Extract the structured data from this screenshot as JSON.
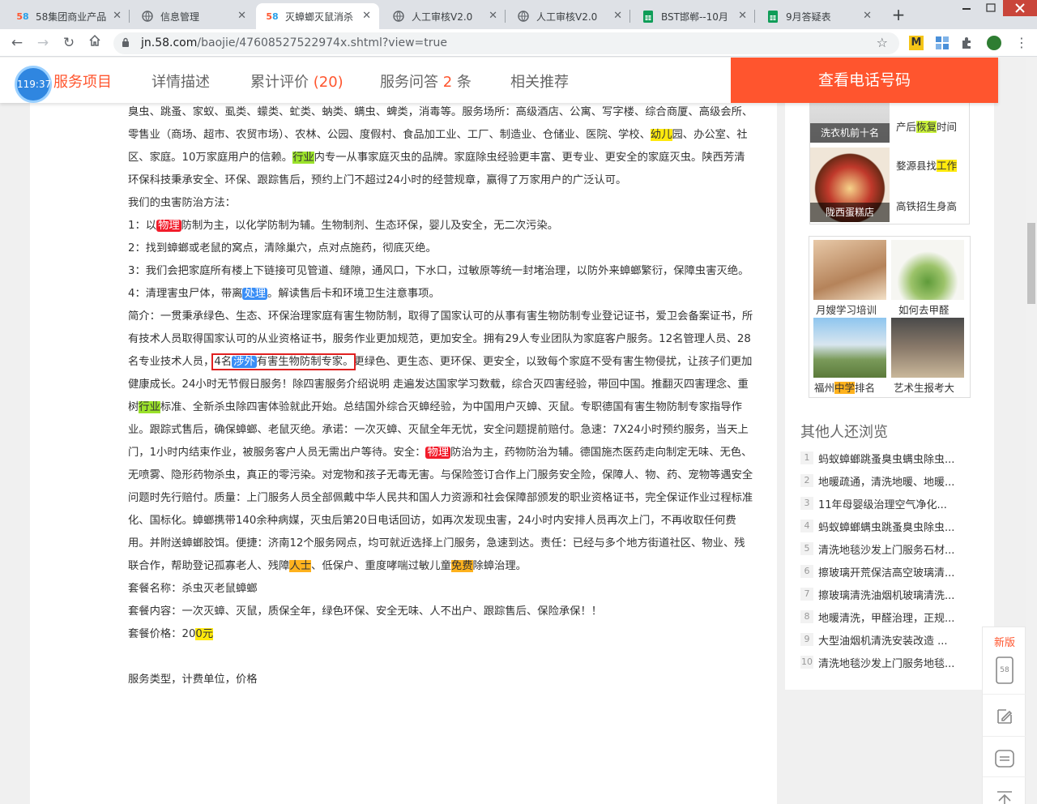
{
  "browser": {
    "tabs": [
      {
        "title": "58集团商业产品",
        "favicon": "58-logo",
        "active": false
      },
      {
        "title": "信息管理",
        "favicon": "globe-icon",
        "active": false
      },
      {
        "title": "灭蟑螂灭鼠消杀",
        "favicon": "58-logo",
        "active": true
      },
      {
        "title": "人工审核V2.0",
        "favicon": "globe-icon",
        "active": false
      },
      {
        "title": "人工审核V2.0",
        "favicon": "globe-icon",
        "active": false
      },
      {
        "title": "BST邯郸--10月",
        "favicon": "sheets-icon",
        "active": false
      },
      {
        "title": "9月答疑表",
        "favicon": "sheets-icon",
        "active": false
      }
    ],
    "url_host": "jn.58.com",
    "url_path": "/baojie/47608527522974x.shtml?view=true"
  },
  "nav": {
    "clock": "119:37",
    "items": [
      {
        "label": "服务项目"
      },
      {
        "label": "详情描述"
      },
      {
        "label": "累计评价 ",
        "count": "(20)"
      },
      {
        "label": "服务问答 ",
        "count": "2",
        "suffix": " 条"
      },
      {
        "label": "相关推荐"
      }
    ],
    "call_button": "查看电话号码"
  },
  "content": {
    "p1a": "臭虫、跳蚤、家蚁、虱类、蠓类、虻类、蚋类、螨虫、蜱类，消毒等。服务场所：高级酒店、公寓、写字楼、综合商厦、高级会所、零售业（商场、超市、农贸市场）、农林、公园、度假村、食品加工业、工厂、制造业、仓储业、医院、学校、",
    "p1b_hl": "幼儿",
    "p1c": "园、办公室、社区、家庭。10万家庭用户的信赖。",
    "p1d_hl": "行业",
    "p1e": "内专一从事家庭灭虫的品牌。家庭除虫经验更丰富、更专业、更安全的家庭灭虫。陕西芳清环保科技秉承安全、环保、跟踪售后，预约上门不超过24小时的经营规章，赢得了万家用户的广泛认可。",
    "methods_title": "我们的虫害防治方法：",
    "m1a": "1：以",
    "m1b_hl": "物理",
    "m1c": "防制为主，以化学防制为辅。生物制剂、生态环保，婴儿及安全，无二次污染。",
    "m2": "2：找到蟑螂或老鼠的窝点，清除巢穴，点对点施药，彻底灭绝。",
    "m3": "3：我们会把家庭所有楼上下链接可见管道、缝隙，通风口，下水口，过敏原等统一封堵治理，以防外来蟑螂繁衍，保障虫害灭绝。",
    "m4a": "4：清理害虫尸体，带离",
    "m4b_hl": "处理",
    "m4c": "。解读售后卡和环境卫生注意事项。",
    "intro_a": "简介：一贯秉承绿色、生态、环保治理家庭有害生物防制，取得了国家认可的从事有害生物防制专业登记证书，爱卫会备案证书，所有技术人员取得国家认可的从业资格证书，服务作业更加规范，更加安全。拥有29人专业团队为家庭客户服务。12名管理人员、28名专业技术人员，",
    "intro_box_a": "4名",
    "intro_box_hl": "涉外",
    "intro_box_b": "有害生物防制专家。",
    "intro_b": "更绿色、更生态、更环保、更安全，以致每个家庭不受有害生物侵扰，让孩子们更加健康成长。24小时无节假日服务！除四害服务介绍说明 走遍发达国家学习数载，综合灭四害经验，带回中国。推翻灭四害理念、重树",
    "intro_hl_c": "行业",
    "intro_c": "标准、全新杀虫除四害体验就此开始。总结国外综合灭蟑经验，为中国用户灭蟑、灭鼠。专职德国有害生物防制专家指导作业。跟踪式售后，确保蟑螂、老鼠灭绝。承诺：一次灭蟑、灭鼠全年无忧，安全问题提前赔付。急速：7X24小时预约服务，当天上门，1小时内结束作业，被服务客户人员无需出户等待。安全：",
    "intro_hl_d": "物理",
    "intro_d": "防治为主，药物防治为辅。德国施杰医药走向制定无味、无色、无喷雾、隐形药物杀虫，真正的零污染。对宠物和孩子无毒无害。与保险签订合作上门服务安全险，保障人、物、药、宠物等遇安全问题时先行赔付。质量：上门服务人员全部佩戴中华人民共和国人力资源和社会保障部颁发的职业资格证书，完全保证作业过程标准化、国标化。蟑螂携带140余种病媒，灭虫后第20日电话回访，如再次发现虫害，24小时内安排人员再次上门，不再收取任何费用。并附送蟑螂胶饵。便捷：济南12个服务网点，均可就近选择上门服务，急速到达。责任：已经与多个地方街道社区、物业、残联合作，帮助登记孤寡老人、残障",
    "intro_hl_e": "人士",
    "intro_e": "、低保户、重度哮喘过敏儿童",
    "intro_hl_f": "免费",
    "intro_f": "除蟑治理。",
    "pkg_name": "套餐名称：杀虫灭老鼠蟑螂",
    "pkg_content": "套餐内容：一次灭蟑、灭鼠，质保全年，绿色环保、安全无味、人不出户、跟踪售后、保险承保！！",
    "pkg_price_a": "套餐价格：20",
    "pkg_price_hl": "0元",
    "service_type": "服务类型，计费单位，价格"
  },
  "ads": {
    "top": [
      {
        "caption": "洗衣机前十名",
        "text_a": "产后",
        "text_hl": "恢复",
        "text_b": "时间"
      },
      {
        "caption": "陇西蛋糕店",
        "text_a": "婺源县找",
        "text_hl": "工作",
        "text_b": "",
        "text2": "高铁招生身高"
      }
    ],
    "grid": [
      {
        "label": "月嫂学习培训"
      },
      {
        "label": "如何去甲醛"
      },
      {
        "label_a": "福州",
        "label_hl": "中学",
        "label_b": "排名"
      },
      {
        "label": "艺术生报考大"
      }
    ]
  },
  "others": {
    "title": "其他人还浏览",
    "items": [
      "蚂蚁蟑螂跳蚤臭虫螨虫除虫...",
      "地暖疏通，清洗地暖、地暖...",
      "11年母婴级治理空气净化...",
      "蚂蚁蟑螂螨虫跳蚤臭虫除虫...",
      "清洗地毯沙发上门服务石材...",
      "擦玻璃开荒保洁高空玻璃清...",
      "擦玻璃清洗油烟机玻璃清洗...",
      "地暖清洗，甲醛治理，正规...",
      "大型油烟机清洗安装改造 ...",
      "清洗地毯沙发上门服务地毯..."
    ]
  },
  "floatbar": {
    "new_label": "新版"
  }
}
